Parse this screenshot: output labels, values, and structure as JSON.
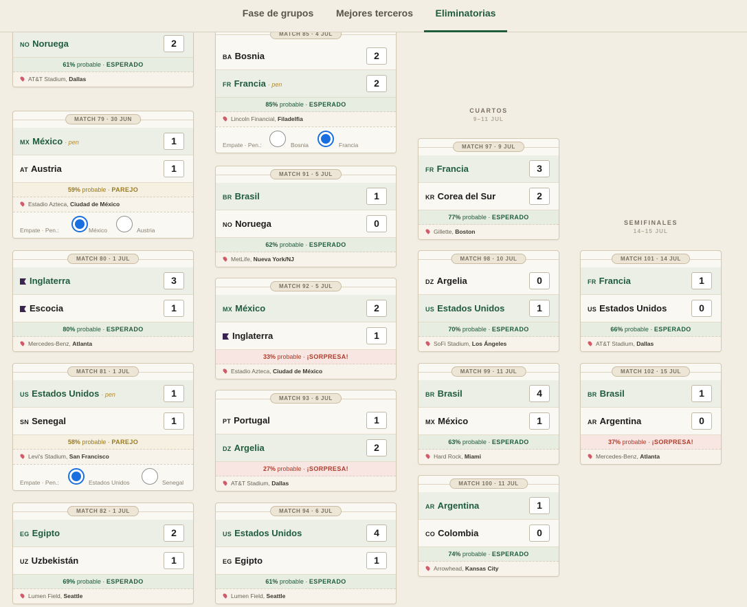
{
  "tabs": [
    {
      "label": "Fase de grupos",
      "active": false
    },
    {
      "label": "Mejores terceros",
      "active": false
    },
    {
      "label": "Eliminatorias",
      "active": true
    }
  ],
  "rounds": {
    "cuartos": {
      "title": "CUARTOS",
      "dates": "9–11 JUL"
    },
    "semis": {
      "title": "SEMIFINALES",
      "dates": "14–15 JUL"
    }
  },
  "common": {
    "probable": "probable",
    "sep": "·",
    "pens_label": "Empate · Pen.:"
  },
  "matches": [
    {
      "id": "m78",
      "header": "",
      "teams": [
        {
          "code": "",
          "name": "",
          "pen": "",
          "score": "",
          "win": false
        },
        {
          "code": "NO",
          "name": "Noruega",
          "pen": "",
          "score": "2",
          "win": true
        }
      ],
      "prob": "61%",
      "status": "ESPERADO",
      "venue": "AT&T Stadium",
      "city": "Dallas"
    },
    {
      "id": "m79",
      "header": "MATCH 79 · 30 JUN",
      "teams": [
        {
          "code": "MX",
          "name": "México",
          "pen": "· pen",
          "score": "1",
          "win": true
        },
        {
          "code": "AT",
          "name": "Austria",
          "pen": "",
          "score": "1",
          "win": false
        }
      ],
      "prob": "59%",
      "status": "PAREJO",
      "venue": "Estadio Azteca",
      "city": "Ciudad de México",
      "pens": {
        "a": "México",
        "b": "Austria",
        "selected": "a"
      }
    },
    {
      "id": "m80",
      "header": "MATCH 80 · 1 JUL",
      "teams": [
        {
          "code": "flag",
          "name": "Inglaterra",
          "pen": "",
          "score": "3",
          "win": true
        },
        {
          "code": "flag",
          "name": "Escocia",
          "pen": "",
          "score": "1",
          "win": false
        }
      ],
      "prob": "80%",
      "status": "ESPERADO",
      "venue": "Mercedes-Benz",
      "city": "Atlanta"
    },
    {
      "id": "m81",
      "header": "MATCH 81 · 1 JUL",
      "teams": [
        {
          "code": "US",
          "name": "Estados Unidos",
          "pen": "· pen",
          "score": "1",
          "win": true
        },
        {
          "code": "SN",
          "name": "Senegal",
          "pen": "",
          "score": "1",
          "win": false
        }
      ],
      "prob": "58%",
      "status": "PAREJO",
      "venue": "Levi's Stadium",
      "city": "San Francisco",
      "pens": {
        "a": "Estados Unidos",
        "b": "Senegal",
        "selected": "a"
      }
    },
    {
      "id": "m82",
      "header": "MATCH 82 · 1 JUL",
      "teams": [
        {
          "code": "EG",
          "name": "Egipto",
          "pen": "",
          "score": "2",
          "win": true
        },
        {
          "code": "UZ",
          "name": "Uzbekistán",
          "pen": "",
          "score": "1",
          "win": false
        }
      ],
      "prob": "69%",
      "status": "ESPERADO",
      "venue": "Lumen Field",
      "city": "Seattle"
    },
    {
      "id": "m85",
      "header": "MATCH 85 · 4 JUL",
      "teams": [
        {
          "code": "BA",
          "name": "Bosnia",
          "pen": "",
          "score": "2",
          "win": false
        },
        {
          "code": "FR",
          "name": "Francia",
          "pen": "· pen",
          "score": "2",
          "win": true
        }
      ],
      "prob": "85%",
      "status": "ESPERADO",
      "venue": "Lincoln Financial",
      "city": "Filadelfia",
      "pens": {
        "a": "Bosnia",
        "b": "Francia",
        "selected": "b"
      }
    },
    {
      "id": "m91",
      "header": "MATCH 91 · 5 JUL",
      "teams": [
        {
          "code": "BR",
          "name": "Brasil",
          "pen": "",
          "score": "1",
          "win": true
        },
        {
          "code": "NO",
          "name": "Noruega",
          "pen": "",
          "score": "0",
          "win": false
        }
      ],
      "prob": "62%",
      "status": "ESPERADO",
      "venue": "MetLife",
      "city": "Nueva York/NJ"
    },
    {
      "id": "m92",
      "header": "MATCH 92 · 5 JUL",
      "teams": [
        {
          "code": "MX",
          "name": "México",
          "pen": "",
          "score": "2",
          "win": true
        },
        {
          "code": "flag",
          "name": "Inglaterra",
          "pen": "",
          "score": "1",
          "win": false
        }
      ],
      "prob": "33%",
      "status": "¡SORPRESA!",
      "venue": "Estadio Azteca",
      "city": "Ciudad de México"
    },
    {
      "id": "m93",
      "header": "MATCH 93 · 6 JUL",
      "teams": [
        {
          "code": "PT",
          "name": "Portugal",
          "pen": "",
          "score": "1",
          "win": false
        },
        {
          "code": "DZ",
          "name": "Argelia",
          "pen": "",
          "score": "2",
          "win": true
        }
      ],
      "prob": "27%",
      "status": "¡SORPRESA!",
      "venue": "AT&T Stadium",
      "city": "Dallas"
    },
    {
      "id": "m94",
      "header": "MATCH 94 · 6 JUL",
      "teams": [
        {
          "code": "US",
          "name": "Estados Unidos",
          "pen": "",
          "score": "4",
          "win": true
        },
        {
          "code": "EG",
          "name": "Egipto",
          "pen": "",
          "score": "1",
          "win": false
        }
      ],
      "prob": "61%",
      "status": "ESPERADO",
      "venue": "Lumen Field",
      "city": "Seattle"
    },
    {
      "id": "m97",
      "header": "MATCH 97 · 9 JUL",
      "teams": [
        {
          "code": "FR",
          "name": "Francia",
          "pen": "",
          "score": "3",
          "win": true
        },
        {
          "code": "KR",
          "name": "Corea del Sur",
          "pen": "",
          "score": "2",
          "win": false
        }
      ],
      "prob": "77%",
      "status": "ESPERADO",
      "venue": "Gillette",
      "city": "Boston"
    },
    {
      "id": "m98",
      "header": "MATCH 98 · 10 JUL",
      "teams": [
        {
          "code": "DZ",
          "name": "Argelia",
          "pen": "",
          "score": "0",
          "win": false
        },
        {
          "code": "US",
          "name": "Estados Unidos",
          "pen": "",
          "score": "1",
          "win": true
        }
      ],
      "prob": "70%",
      "status": "ESPERADO",
      "venue": "SoFi Stadium",
      "city": "Los Ángeles"
    },
    {
      "id": "m99",
      "header": "MATCH 99 · 11 JUL",
      "teams": [
        {
          "code": "BR",
          "name": "Brasil",
          "pen": "",
          "score": "4",
          "win": true
        },
        {
          "code": "MX",
          "name": "México",
          "pen": "",
          "score": "1",
          "win": false
        }
      ],
      "prob": "63%",
      "status": "ESPERADO",
      "venue": "Hard Rock",
      "city": "Miami"
    },
    {
      "id": "m100",
      "header": "MATCH 100 · 11 JUL",
      "teams": [
        {
          "code": "AR",
          "name": "Argentina",
          "pen": "",
          "score": "1",
          "win": true
        },
        {
          "code": "CO",
          "name": "Colombia",
          "pen": "",
          "score": "0",
          "win": false
        }
      ],
      "prob": "74%",
      "status": "ESPERADO",
      "venue": "Arrowhead",
      "city": "Kansas City"
    },
    {
      "id": "m101",
      "header": "MATCH 101 · 14 JUL",
      "teams": [
        {
          "code": "FR",
          "name": "Francia",
          "pen": "",
          "score": "1",
          "win": true
        },
        {
          "code": "US",
          "name": "Estados Unidos",
          "pen": "",
          "score": "0",
          "win": false
        }
      ],
      "prob": "66%",
      "status": "ESPERADO",
      "venue": "AT&T Stadium",
      "city": "Dallas"
    },
    {
      "id": "m102",
      "header": "MATCH 102 · 15 JUL",
      "teams": [
        {
          "code": "BR",
          "name": "Brasil",
          "pen": "",
          "score": "1",
          "win": true
        },
        {
          "code": "AR",
          "name": "Argentina",
          "pen": "",
          "score": "0",
          "win": false
        }
      ],
      "prob": "37%",
      "status": "¡SORPRESA!",
      "venue": "Mercedes-Benz",
      "city": "Atlanta"
    }
  ]
}
